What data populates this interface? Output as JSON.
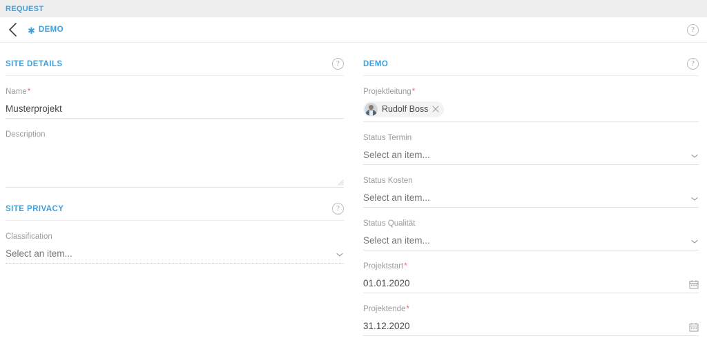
{
  "top_bar": {
    "label": "REQUEST"
  },
  "header": {
    "back_icon": "chevron-left-icon",
    "asterisk_icon": "asterisk-icon",
    "title": "DEMO",
    "help_icon": "help-circle-icon"
  },
  "left_column": {
    "sections": [
      {
        "title": "SITE DETAILS",
        "help_icon": "help-circle-icon",
        "fields": [
          {
            "label": "Name",
            "required": "*",
            "type": "text",
            "value": "Musterprojekt",
            "placeholder": ""
          },
          {
            "label": "Description",
            "required": "",
            "type": "textarea",
            "value": "",
            "placeholder": ""
          }
        ]
      },
      {
        "title": "SITE PRIVACY",
        "help_icon": "help-circle-icon",
        "fields": [
          {
            "label": "Classification",
            "required": "",
            "type": "select-dotted",
            "value": "",
            "placeholder": "Select an item..."
          }
        ]
      }
    ]
  },
  "right_column": {
    "sections": [
      {
        "title": "DEMO",
        "help_icon": "help-circle-icon",
        "fields": [
          {
            "label": "Projektleitung",
            "required": "*",
            "type": "people",
            "person": {
              "name": "Rudolf Boss",
              "avatar_icon": "person-avatar",
              "remove_icon": "close-icon"
            }
          },
          {
            "label": "Status Termin",
            "required": "",
            "type": "select",
            "value": "",
            "placeholder": "Select an item..."
          },
          {
            "label": "Status Kosten",
            "required": "",
            "type": "select",
            "value": "",
            "placeholder": "Select an item..."
          },
          {
            "label": "Status Qualität",
            "required": "",
            "type": "select",
            "value": "",
            "placeholder": "Select an item..."
          },
          {
            "label": "Projektstart",
            "required": "*",
            "type": "date",
            "value": "01.01.2020",
            "placeholder": ""
          },
          {
            "label": "Projektende",
            "required": "*",
            "type": "date",
            "value": "31.12.2020",
            "placeholder": ""
          }
        ]
      }
    ]
  },
  "colors": {
    "accent_blue": "#3f9fdc",
    "required_red": "#e8695f",
    "label_gray": "#9b9b9b",
    "value_gray": "#4a4a4a",
    "bar_background": "#eeeeee",
    "underline": "#e2e2e2"
  }
}
